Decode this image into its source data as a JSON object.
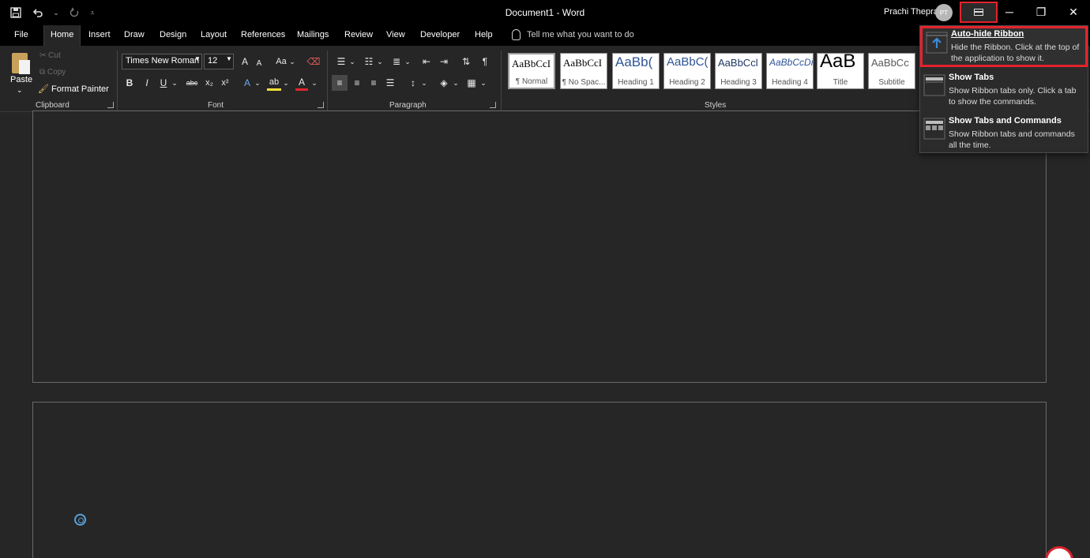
{
  "titlebar": {
    "document_title": "Document1  -  Word",
    "user_name": "Prachi Thepra",
    "user_initials": "PT",
    "qat_save_icon": "save-icon",
    "qat_undo_icon": "undo-icon",
    "qat_redo_icon": "redo-icon",
    "window_controls": [
      "minimize",
      "restore",
      "close"
    ],
    "minimize_glyph": "─",
    "restore_glyph": "❐",
    "close_glyph": "✕"
  },
  "tabs": [
    "File",
    "Home",
    "Insert",
    "Draw",
    "Design",
    "Layout",
    "References",
    "Mailings",
    "Review",
    "View",
    "Developer",
    "Help"
  ],
  "active_tab": "Home",
  "tell_me": {
    "placeholder": "Tell me what you want to do"
  },
  "ribbon": {
    "clipboard": {
      "label": "Clipboard",
      "paste": "Paste",
      "cut": "Cut",
      "copy": "Copy",
      "format_painter": "Format Painter"
    },
    "font": {
      "label": "Font",
      "font_name": "Times New Roman",
      "font_size": "12",
      "grow": "A",
      "shrink": "A",
      "change_case": "Aa",
      "bold": "B",
      "italic": "I",
      "underline": "U",
      "strikethrough": "abc",
      "subscript": "x₂",
      "superscript": "x²",
      "text_effects": "A",
      "highlight": "ab",
      "font_color": "A"
    },
    "paragraph": {
      "label": "Paragraph",
      "show_marks": "¶"
    },
    "styles": {
      "label": "Styles",
      "items": [
        {
          "sample": "AaBbCcI",
          "name": "¶ Normal"
        },
        {
          "sample": "AaBbCcI",
          "name": "¶ No Spac..."
        },
        {
          "sample": "AaBb(",
          "name": "Heading 1"
        },
        {
          "sample": "AaBbC(",
          "name": "Heading 2"
        },
        {
          "sample": "AaBbCcl",
          "name": "Heading 3"
        },
        {
          "sample": "AaBbCcDi",
          "name": "Heading 4"
        },
        {
          "sample": "AaB",
          "name": "Title"
        },
        {
          "sample": "AaBbCc",
          "name": "Subtitle"
        }
      ]
    }
  },
  "ribbon_display_options": {
    "items": [
      {
        "title": "Auto-hide Ribbon",
        "description": "Hide the Ribbon. Click at the top of the application to show it.",
        "icon": "auto-hide-icon"
      },
      {
        "title": "Show Tabs",
        "description": "Show Ribbon tabs only. Click a tab to show the commands.",
        "icon": "show-tabs-icon"
      },
      {
        "title": "Show Tabs and Commands",
        "description": "Show Ribbon tabs and commands all the time.",
        "icon": "show-tabs-commands-icon"
      }
    ],
    "highlighted": "Auto-hide Ribbon"
  },
  "colors": {
    "highlight_red": "#e3232e",
    "background": "#262626",
    "titlebar": "#000000",
    "heading_blue": "#2f5496"
  }
}
